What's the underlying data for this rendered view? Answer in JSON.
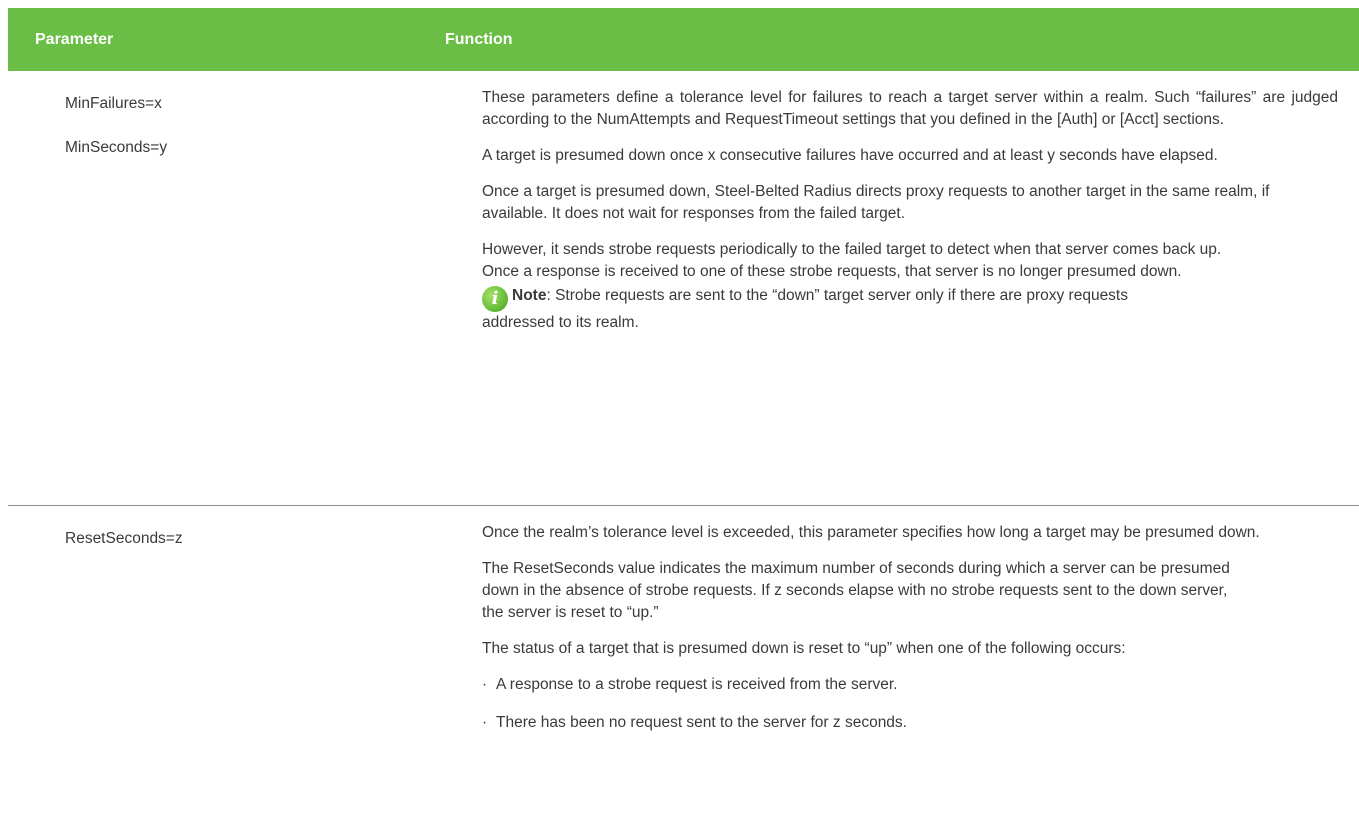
{
  "header": {
    "param_label": "Parameter",
    "func_label": "Function"
  },
  "rows": [
    {
      "params": [
        "MinFailures=x",
        "MinSeconds=y"
      ],
      "paragraphs": [
        "These parameters define a tolerance level for failures to reach a target server within a realm. Such “failures” are judged according to the NumAttempts and RequestTimeout settings that you defined in the [Auth] or [Acct] sections.",
        "A target is presumed down once x consecutive failures have occurred and at least y seconds have elapsed.",
        " Once a target is presumed down, Steel-Belted Radius directs proxy requests to another target in the same realm, if available. It does not wait for responses from the failed target.",
        "However, it sends strobe requests periodically to the failed target to detect when that server comes back up. Once a response is received to one of these strobe requests, that server is no longer presumed down."
      ],
      "note": {
        "icon_glyph": "i",
        "label": "Note",
        "text": ": Strobe requests are sent to the “down” target server only if there are proxy   requests addressed to its realm."
      }
    },
    {
      "params": [
        "ResetSeconds=z"
      ],
      "paragraphs": [
        "Once the realm’s tolerance level is exceeded, this parameter specifies how long a target may be presumed down.",
        "The ResetSeconds value indicates the maximum number of seconds during which a server can be presumed down in the absence of strobe requests. If z seconds elapse with no strobe requests sent to the down server, the server is reset to “up.”",
        "The status of a target that is presumed down is reset to “up” when one of the following occurs:"
      ],
      "bullets": [
        "A response to a strobe request is received from the server.",
        "There has been no request sent to the server for z seconds."
      ],
      "bullet_glyph": "·"
    }
  ],
  "colors": {
    "header_bg": "#6abd45",
    "header_text": "#ffffff",
    "body_text": "#3a3a3a",
    "divider": "#8c8c8c",
    "note_icon": "#6cc13d"
  },
  "icons": {
    "note": "info-icon"
  }
}
